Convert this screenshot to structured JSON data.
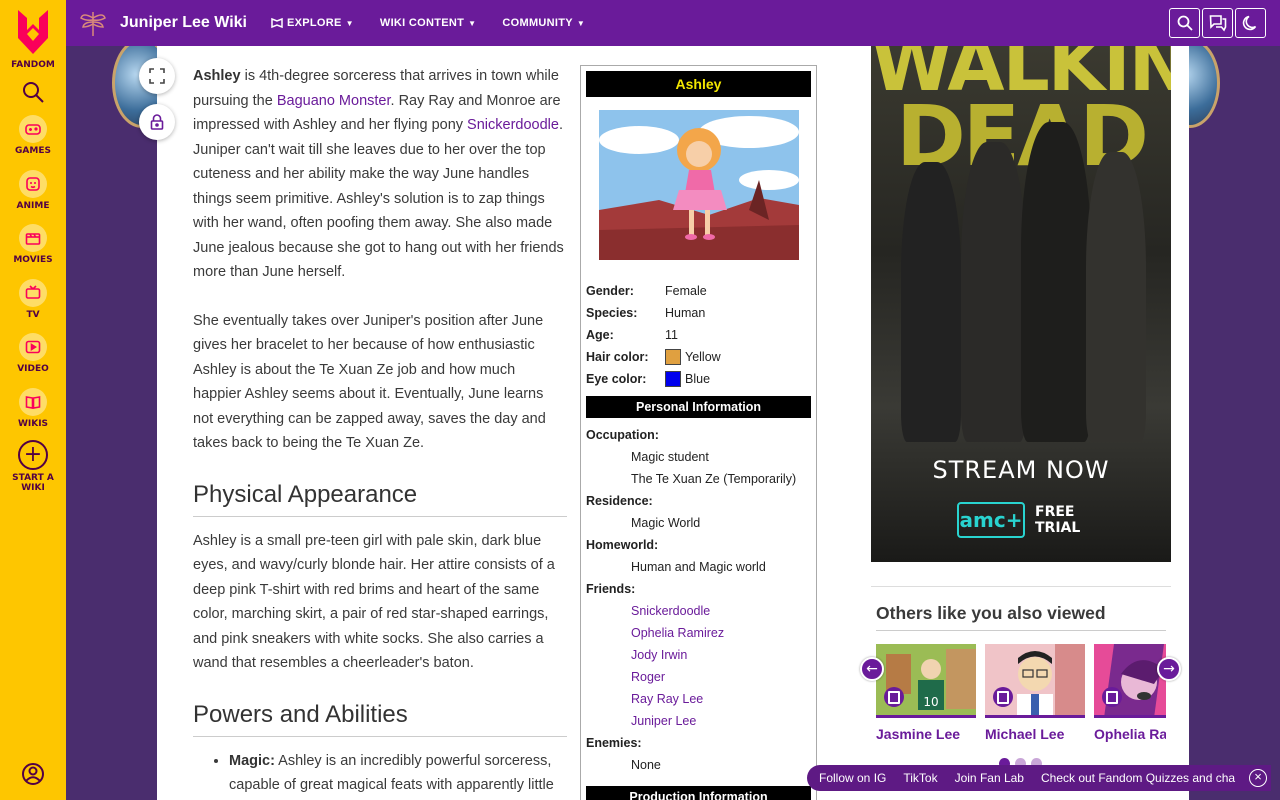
{
  "fandom": {
    "logo_text": "FANDOM",
    "nav": [
      {
        "label": "GAMES",
        "icon": "gamepad-icon"
      },
      {
        "label": "ANIME",
        "icon": "anime-icon"
      },
      {
        "label": "MOVIES",
        "icon": "clapperboard-icon"
      },
      {
        "label": "TV",
        "icon": "tv-icon"
      },
      {
        "label": "VIDEO",
        "icon": "play-icon"
      },
      {
        "label": "WIKIS",
        "icon": "book-icon"
      }
    ],
    "start_wiki_label": "START A WIKI"
  },
  "topbar": {
    "wiki_name": "Juniper Lee Wiki",
    "nav": [
      "EXPLORE",
      "WIKI CONTENT",
      "COMMUNITY"
    ]
  },
  "article": {
    "intro_bold": "Ashley",
    "intro_1": " is 4th-degree sorceress that arrives in town while pursuing the ",
    "intro_link_1": "Baguano Monster",
    "intro_2": ". Ray Ray and Monroe are impressed with Ashley and her flying pony ",
    "intro_link_2": "Snickerdoodle",
    "intro_3": ". Juniper can't wait till she leaves due to her over the top cuteness and her ability make the way June handles things seem primitive. Ashley's solution is to zap things with her wand, often poofing them away. She also made June jealous because she got to hang out with her friends more than June herself.",
    "para_2": "She eventually takes over Juniper's position after June gives her bracelet to her because of how enthusiastic Ashley is about the Te Xuan Ze job and how much happier Ashley seems about it. Eventually, June learns not everything can be zapped away, saves the day and takes back to being the Te Xuan Ze.",
    "h_physical": "Physical Appearance",
    "physical": "Ashley is a small pre-teen girl with pale skin, dark blue eyes, and wavy/curly blonde hair. Her attire consists of a deep pink T-shirt with red brims and heart of the same color, marching skirt, a pair of red star-shaped earrings, and pink sneakers with white socks. She also carries a wand that resembles a cheerleader's baton.",
    "h_powers": "Powers and Abilities",
    "magic_bold": "Magic:",
    "magic_text": " Ashley is an incredibly powerful sorceress, capable of great magical feats with apparently little"
  },
  "infobox": {
    "title": "Ashley",
    "rows": [
      {
        "key": "Gender:",
        "value": "Female"
      },
      {
        "key": "Species:",
        "value": "Human"
      },
      {
        "key": "Age:",
        "value": "11"
      }
    ],
    "hair_key": "Hair color:",
    "hair_value": "Yellow",
    "hair_swatch": "#e0a040",
    "eye_key": "Eye color:",
    "eye_value": "Blue",
    "eye_swatch": "#0000ee",
    "personal_header": "Personal Information",
    "occupation_key": "Occupation:",
    "occupation": [
      "Magic student",
      "The Te Xuan Ze (Temporarily)"
    ],
    "residence_key": "Residence:",
    "residence": "Magic World",
    "homeworld_key": "Homeworld:",
    "homeworld": "Human and Magic world",
    "friends_key": "Friends:",
    "friends": [
      "Snickerdoodle",
      "Ophelia Ramirez",
      "Jody Irwin",
      "Roger",
      "Ray Ray Lee",
      "Juniper Lee"
    ],
    "enemies_key": "Enemies:",
    "enemies": "None",
    "production_header": "Production Information"
  },
  "ad": {
    "title_1": "WALKING",
    "title_2": "DEAD",
    "stream": "STREAM NOW",
    "brand": "amc+",
    "trial_1": "FREE",
    "trial_2": "TRIAL"
  },
  "rail": {
    "others_title": "Others like you also viewed",
    "cards": [
      "Jasmine Lee",
      "Michael Lee",
      "Ophelia Ra"
    ]
  },
  "bottom_bar": {
    "links": [
      "Follow on IG",
      "TikTok",
      "Join Fan Lab",
      "Check out Fandom Quizzes and cha"
    ]
  }
}
